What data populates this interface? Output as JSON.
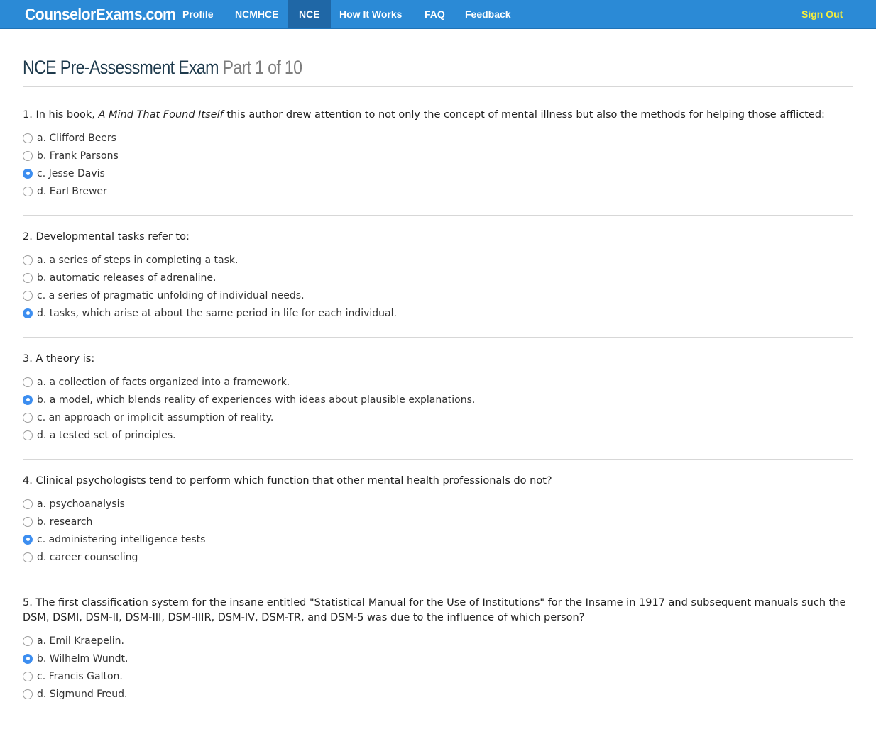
{
  "nav": {
    "brand": "CounselorExams.com",
    "items": [
      {
        "label": "Profile"
      },
      {
        "label": "NCMHCE"
      },
      {
        "label": "NCE"
      },
      {
        "label": "How It Works"
      },
      {
        "label": "FAQ"
      },
      {
        "label": "Feedback"
      }
    ],
    "active_item": "NCE",
    "sign_out": "Sign Out"
  },
  "page": {
    "title_main": "NCE Pre-Assessment Exam",
    "title_part": "Part 1 of 10"
  },
  "questions": [
    {
      "number_prefix": "1. In his book, ",
      "book_title": "A Mind That Found Itself",
      "text_suffix": " this author drew attention to not only the concept of mental illness but also the methods for helping those afflicted:",
      "options": [
        "a. Clifford Beers",
        "b. Frank Parsons",
        "c. Jesse Davis",
        "d. Earl Brewer"
      ],
      "selected": 2
    },
    {
      "text": "2. Developmental tasks refer to:",
      "options": [
        "a. a series of steps in completing a task.",
        "b. automatic releases of adrenaline.",
        "c. a series of pragmatic unfolding of individual needs.",
        "d. tasks, which arise at about the same period in life for each individual."
      ],
      "selected": 3
    },
    {
      "text": "3. A theory is:",
      "options": [
        "a. a collection of facts organized into a framework.",
        "b. a model, which blends reality of experiences with ideas about plausible explanations.",
        "c. an approach or implicit assumption of reality.",
        "d. a tested set of principles."
      ],
      "selected": 1
    },
    {
      "text": "4. Clinical psychologists tend to perform which function that other mental health professionals do not?",
      "options": [
        "a. psychoanalysis",
        "b. research",
        "c. administering intelligence tests",
        "d. career counseling"
      ],
      "selected": 2
    },
    {
      "text": "5. The first classification system for the insane entitled \"Statistical Manual for the Use of Institutions\" for the Insame in 1917 and subsequent manuals such the DSM, DSMI, DSM-II, DSM-III, DSM-IIIR, DSM-IV, DSM-TR, and DSM-5 was due to the influence of which person?",
      "options": [
        "a. Emil Kraepelin.",
        "b. Wilhelm Wundt.",
        "c. Francis Galton.",
        "d. Sigmund Freud."
      ],
      "selected": 1
    }
  ],
  "colors": {
    "nav_bg": "#2b8ad6",
    "nav_active_bg": "#1f67a6",
    "sign_out": "#f6ee3c",
    "radio_checked": "#3d8ef0",
    "title": "#1e3a4c"
  }
}
